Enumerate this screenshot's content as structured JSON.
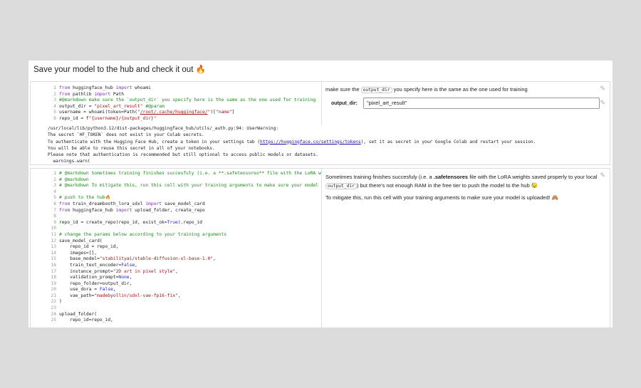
{
  "title": "Save your model to the hub and check it out 🔥",
  "cell1": {
    "code": [
      [
        [
          "from",
          "k"
        ],
        [
          " huggingface_hub ",
          ""
        ],
        [
          "import",
          "k"
        ],
        [
          " whoami",
          ""
        ]
      ],
      [
        [
          "from",
          "k"
        ],
        [
          " pathlib ",
          ""
        ],
        [
          "import",
          "k"
        ],
        [
          " Path",
          ""
        ]
      ],
      [
        [
          "#@markdown make sure the `output_dir` you specify here is the same as the one used for training",
          "c"
        ]
      ],
      [
        [
          "output_dir = ",
          ""
        ],
        [
          "\"pixel_art_result\"",
          "s"
        ],
        [
          " #@param",
          "c"
        ]
      ],
      [
        [
          "username = whoami(token=Path(",
          ""
        ],
        [
          "\"",
          "s"
        ],
        [
          "/root/.cache/huggingface/",
          "u"
        ],
        [
          "\"",
          "s"
        ],
        [
          ")[",
          ""
        ],
        [
          "\"name\"",
          "s"
        ],
        [
          "]",
          ""
        ]
      ],
      [
        [
          "repo_id = f",
          ""
        ],
        [
          "\"{username}/{output_dir}\"",
          "s"
        ]
      ]
    ],
    "output": [
      "/usr/local/lib/python3.12/dist-packages/huggingface_hub/utils/_auth.py:94: UserWarning:",
      "The secret `HF_TOKEN` does not exist in your Colab secrets.",
      "To authenticate with the Hugging Face Hub, create a token in your settings tab (",
      "You will be able to reuse this secret in all of your notebooks.",
      "Please note that authentication is recommended but still optional to access public models or datasets.",
      "  warnings.warn("
    ],
    "output_link": "https://huggingface.co/settings/tokens",
    "output_link_after": "), set it as secret in your Google Colab and restart your session.",
    "form_text_before": "make sure the",
    "form_chip": "output_dir",
    "form_text_after": "you specify here is the same as the one used for training",
    "field_label": "output_dir:",
    "field_value": "\"pixel_art_result\""
  },
  "cell2": {
    "code": [
      [
        [
          "# @markdown Sometimes training finishes succesfuly (i.e. a **.safetensores** file with the LoRA weights saved properly to your",
          "c"
        ]
      ],
      [
        [
          "# @markdown",
          "c"
        ]
      ],
      [
        [
          "# @markdown To mitigate this, run this cell with your training arguments to make sure your model is uploaded!",
          "c"
        ]
      ],
      [
        [
          "",
          ""
        ]
      ],
      [
        [
          "# push to the hub🔥",
          "c"
        ]
      ],
      [
        [
          "from",
          "k"
        ],
        [
          " train_dreambooth_lora_sdxl ",
          ""
        ],
        [
          "import",
          "k"
        ],
        [
          " save_model_card",
          ""
        ]
      ],
      [
        [
          "from",
          "k"
        ],
        [
          " huggingface_hub ",
          ""
        ],
        [
          "import",
          "k"
        ],
        [
          " upload_folder, create_repo",
          ""
        ]
      ],
      [
        [
          "",
          ""
        ]
      ],
      [
        [
          "repo_id = create_repo(repo_id, exist_ok=",
          ""
        ],
        [
          "True",
          "b"
        ],
        [
          ").repo_id",
          ""
        ]
      ],
      [
        [
          "",
          ""
        ]
      ],
      [
        [
          "# change the params below according to your training arguments",
          "c"
        ]
      ],
      [
        [
          "save_model_card(",
          ""
        ]
      ],
      [
        [
          "    repo_id = repo_id,",
          ""
        ]
      ],
      [
        [
          "    images=[],",
          ""
        ]
      ],
      [
        [
          "    base_model=",
          ""
        ],
        [
          "\"stabilityai/stable-diffusion-xl-base-1.0\"",
          "s"
        ],
        [
          ",",
          ""
        ]
      ],
      [
        [
          "    train_text_encoder=",
          ""
        ],
        [
          "False",
          "b"
        ],
        [
          ",",
          ""
        ]
      ],
      [
        [
          "    instance_prompt=",
          ""
        ],
        [
          "\"2D art in pixel style\"",
          "s"
        ],
        [
          ",",
          ""
        ]
      ],
      [
        [
          "    validation_prompt=",
          ""
        ],
        [
          "None",
          "b"
        ],
        [
          ",",
          ""
        ]
      ],
      [
        [
          "    repo_folder=output_dir,",
          ""
        ]
      ],
      [
        [
          "    use_dora = ",
          ""
        ],
        [
          "False",
          "b"
        ],
        [
          ",",
          ""
        ]
      ],
      [
        [
          "    vae_path=",
          ""
        ],
        [
          "\"madebyollin/sdxl-vae-fp16-fix\"",
          "s"
        ],
        [
          ",",
          ""
        ]
      ],
      [
        [
          ")",
          ""
        ]
      ],
      [
        [
          "",
          ""
        ]
      ],
      [
        [
          "upload_folder(",
          ""
        ]
      ],
      [
        [
          "    repo_id=repo_id,",
          ""
        ]
      ]
    ],
    "md1_before": "Sometimes training finishes succesfuly (i.e. a",
    "md1_bold": ".safetensores",
    "md1_after": "file with the LoRA weights saved properly to your local",
    "md1_chip": "output_dir",
    "md1_end": ") but there's not enough RAM in the free tier to push the model to the hub 😓",
    "md2": "To mitigate this, run this cell with your training arguments to make sure your model is uploaded! 🙈"
  }
}
